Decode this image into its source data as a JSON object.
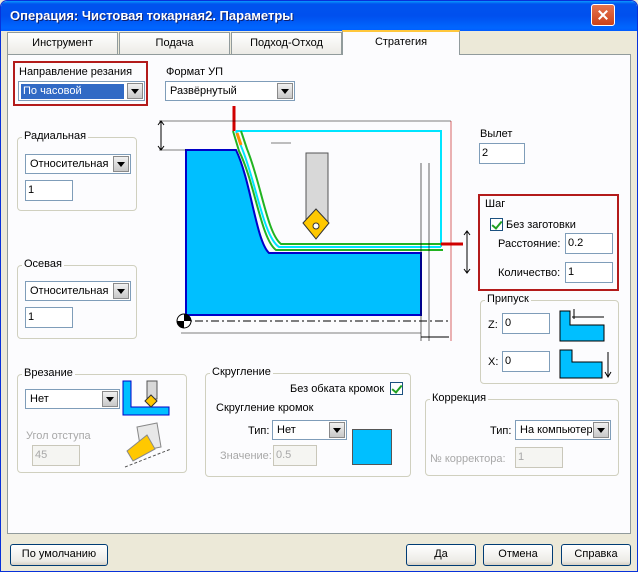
{
  "window": {
    "title": "Операция: Чистовая токарная2. Параметры"
  },
  "tabs": [
    "Инструмент",
    "Подача",
    "Подход-Отход",
    "Стратегия"
  ],
  "cut_direction": {
    "label": "Направление резания",
    "value": "По часовой"
  },
  "nc_format": {
    "label": "Формат УП",
    "value": "Развёрнутый"
  },
  "radial": {
    "label": "Радиальная",
    "mode": "Относительная",
    "value": "1"
  },
  "axial": {
    "label": "Осевая",
    "mode": "Относительная",
    "value": "1"
  },
  "overhang": {
    "label": "Вылет",
    "value": "2"
  },
  "step": {
    "label": "Шаг",
    "no_stock_label": "Без заготовки",
    "no_stock_checked": true,
    "distance_label": "Расстояние:",
    "distance_value": "0.2",
    "count_label": "Количество:",
    "count_value": "1"
  },
  "allowance": {
    "label": "Припуск",
    "z_label": "Z:",
    "z_value": "0",
    "x_label": "X:",
    "x_value": "0"
  },
  "plunge": {
    "label": "Врезание",
    "value": "Нет",
    "angle_label": "Угол отступа",
    "angle_value": "45"
  },
  "rounding": {
    "label": "Скругление",
    "no_edge_label": "Без обката кромок",
    "no_edge_checked": true,
    "edge_label": "Скругление кромок",
    "type_label": "Тип:",
    "type_value": "Нет",
    "value_label": "Значение:",
    "value_value": "0.5"
  },
  "correction": {
    "label": "Коррекция",
    "type_label": "Тип:",
    "type_value": "На компьютере",
    "corrector_label": "№ корректора:",
    "corrector_value": "1"
  },
  "buttons": {
    "default": "По умолчанию",
    "ok": "Да",
    "cancel": "Отмена",
    "help": "Справка"
  },
  "colors": {
    "accent_red": "#b31b1b",
    "part_blue": "#00bfff",
    "path_green": "#21b321",
    "path_cyan": "#00e5ff",
    "title_blue": "#0054e3"
  }
}
